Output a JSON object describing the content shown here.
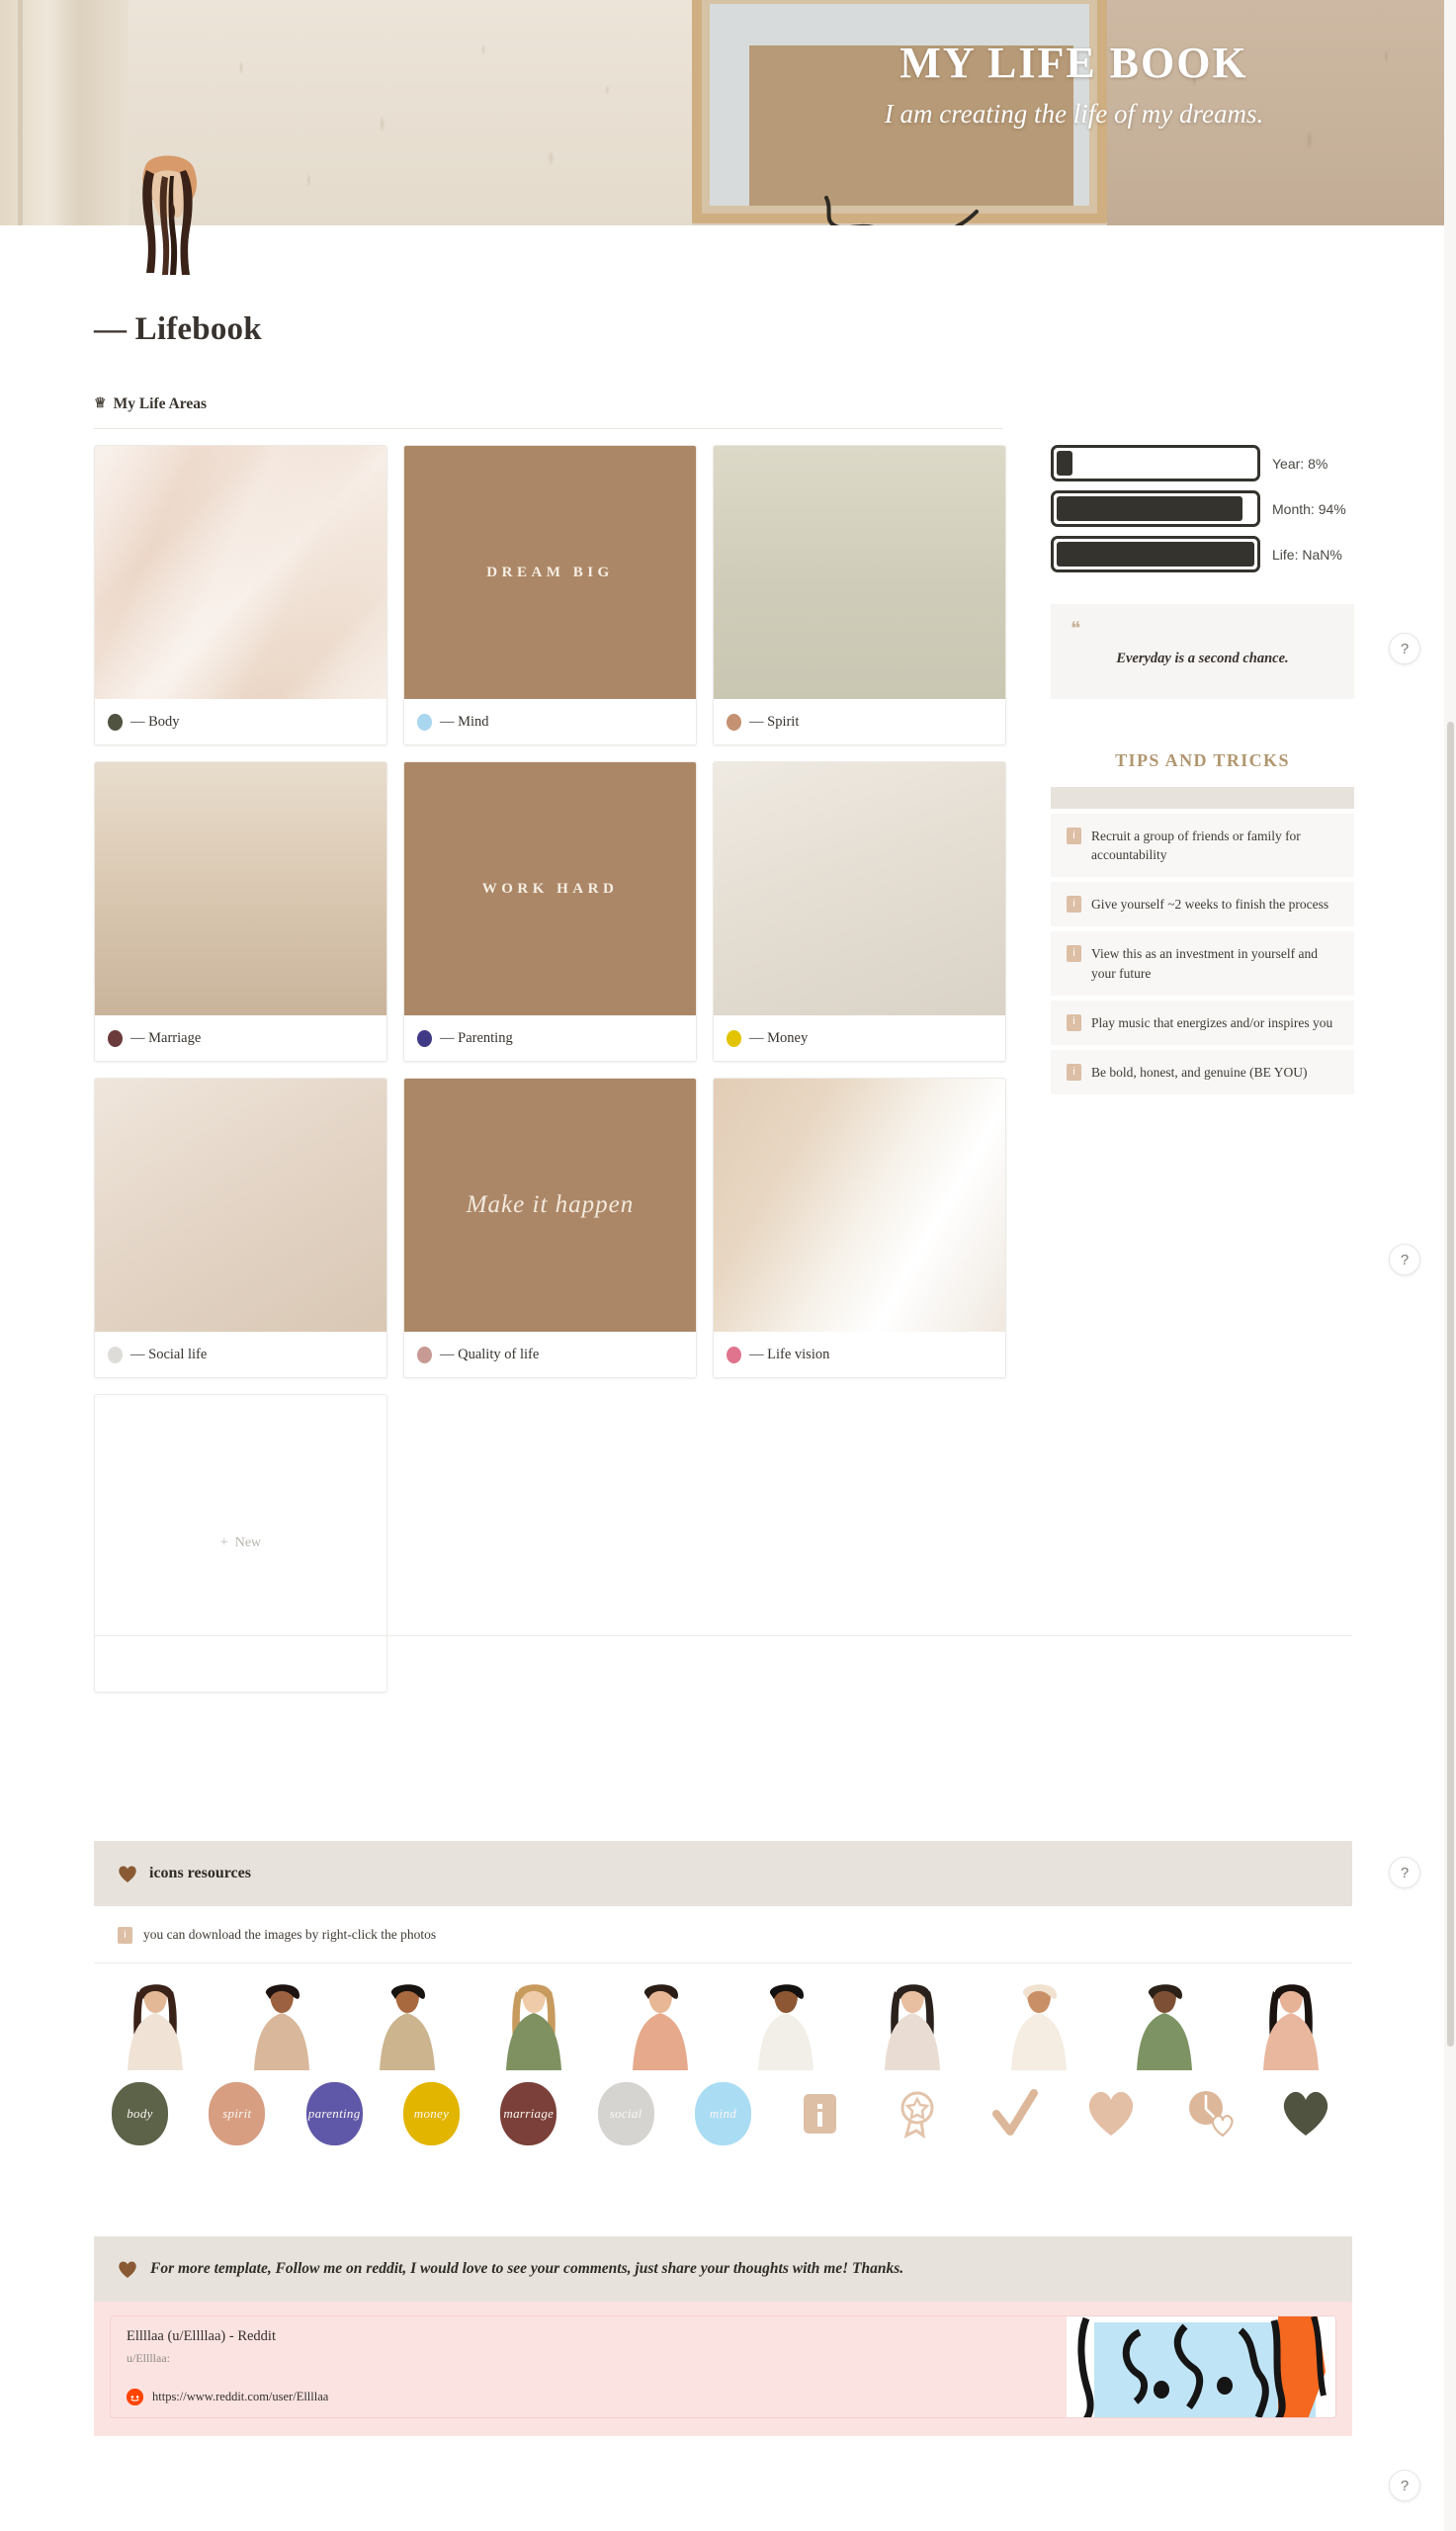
{
  "cover": {
    "title": "MY LIFE BOOK",
    "subtitle": "I am creating the life of my dreams."
  },
  "page": {
    "title": "— Lifebook",
    "section_label": "My Life Areas",
    "crown_icon": "crown-icon"
  },
  "life_areas": [
    {
      "label": "— Body",
      "dot": "#4f5340",
      "overlay": "",
      "style": "img-silk"
    },
    {
      "label": "— Mind",
      "dot": "#a8d6ef",
      "overlay": "DREAM BIG",
      "style": "img-tan"
    },
    {
      "label": "— Spirit",
      "dot": "#c59173",
      "overlay": "",
      "style": "img-birds"
    },
    {
      "label": "— Marriage",
      "dot": "#6b3b3c",
      "overlay": "",
      "style": "img-arch"
    },
    {
      "label": "— Parenting",
      "dot": "#403a86",
      "overlay": "WORK HARD",
      "style": "img-tan"
    },
    {
      "label": "— Money",
      "dot": "#e2c400",
      "overlay": "",
      "style": "img-shell"
    },
    {
      "label": "— Social life",
      "dot": "#dedcd9",
      "overlay": "",
      "style": "img-env"
    },
    {
      "label": "— Quality of life",
      "dot": "#c89a94",
      "overlay": "Make it happen",
      "style": "img-tan"
    },
    {
      "label": "— Life vision",
      "dot": "#e0748f",
      "overlay": "",
      "style": "img-beach"
    }
  ],
  "new_card": {
    "label": "New",
    "plus": "+"
  },
  "progress": [
    {
      "label": "Year: 8%",
      "percent": 8
    },
    {
      "label": "Month: 94%",
      "percent": 94
    },
    {
      "label": "Life: NaN%",
      "percent": 100
    }
  ],
  "quote": {
    "mark": "❝",
    "text": "Everyday is a second chance."
  },
  "tips": {
    "title": "TIPS AND TRICKS",
    "items": [
      "Recruit a group of friends or family for accountability",
      "Give yourself ~2 weeks to finish the process",
      "View this as an investment in yourself and your future",
      "Play music that energizes and/or inspires you",
      "Be bold, honest, and genuine (BE YOU)"
    ],
    "chip": "i"
  },
  "help_buttons": [
    {
      "label": "?"
    },
    {
      "label": "?"
    },
    {
      "label": "?"
    },
    {
      "label": "?"
    }
  ],
  "resources": {
    "heading": "icons resources",
    "heart_icon": "heart-icon",
    "note": "you can download the images by right-click the photos",
    "note_chip": "i",
    "people_icons": [
      "woman-long-hair-icon",
      "woman-curly-hair-icon",
      "woman-headwrap-icon",
      "woman-green-dress-icon",
      "woman-plant-icon",
      "woman-afro-icon",
      "woman-bob-icon",
      "woman-hat-icon",
      "woman-standing-icon",
      "woman-dress-icon"
    ],
    "circle_icons": [
      {
        "label": "body",
        "color": "#5c6349"
      },
      {
        "label": "spirit",
        "color": "#d79e82"
      },
      {
        "label": "parenting",
        "color": "#5f58a8"
      },
      {
        "label": "money",
        "color": "#e2b500"
      },
      {
        "label": "marriage",
        "color": "#7b4039"
      },
      {
        "label": "social",
        "color": "#d6d4d1"
      },
      {
        "label": "mind",
        "color": "#aadcf4"
      }
    ],
    "symbol_icons": [
      {
        "name": "info-icon",
        "glyph": "i"
      },
      {
        "name": "award-badge-icon",
        "glyph": ""
      },
      {
        "name": "checkmark-icon",
        "glyph": ""
      },
      {
        "name": "heart-tan-icon",
        "glyph": ""
      },
      {
        "name": "clock-heart-icon",
        "glyph": ""
      },
      {
        "name": "heart-olive-icon",
        "glyph": ""
      }
    ]
  },
  "footer": {
    "heart_icon": "heart-icon",
    "message": "For more template, Follow me on reddit, I would love to see your comments, just share your thoughts with me!  Thanks.",
    "link_card": {
      "title": "Ellllaa (u/Ellllaa) - Reddit",
      "subtitle": "u/Ellllaa:",
      "url": "https://www.reddit.com/user/Ellllaa",
      "favicon": "reddit-icon"
    }
  }
}
